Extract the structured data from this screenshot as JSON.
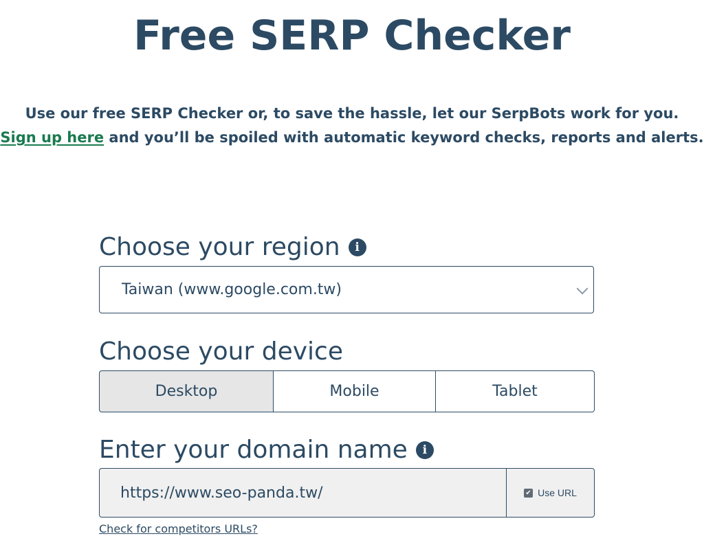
{
  "page": {
    "title": "Free SERP Checker"
  },
  "intro": {
    "line1": "Use our free SERP Checker or, to save the hassle, let our SerpBots work for you.",
    "signup_link": "Sign up here",
    "line2_rest": " and you’ll be spoiled with automatic keyword checks, reports and alerts."
  },
  "region": {
    "label": "Choose your region",
    "info_icon": "i",
    "selected": "Taiwan (www.google.com.tw)"
  },
  "device": {
    "label": "Choose your device",
    "options": [
      "Desktop",
      "Mobile",
      "Tablet"
    ],
    "selected": "Desktop"
  },
  "domain": {
    "label": "Enter your domain name",
    "info_icon": "i",
    "value": "https://www.seo-panda.tw/",
    "use_url_label": "Use URL",
    "use_url_checked": true,
    "competitors_link": "Check for competitors URLs?"
  },
  "colors": {
    "primary": "#2c4a63",
    "link_green": "#1a7a4f",
    "active_bg": "#e6e6e6",
    "input_bg": "#f0f0f0"
  }
}
